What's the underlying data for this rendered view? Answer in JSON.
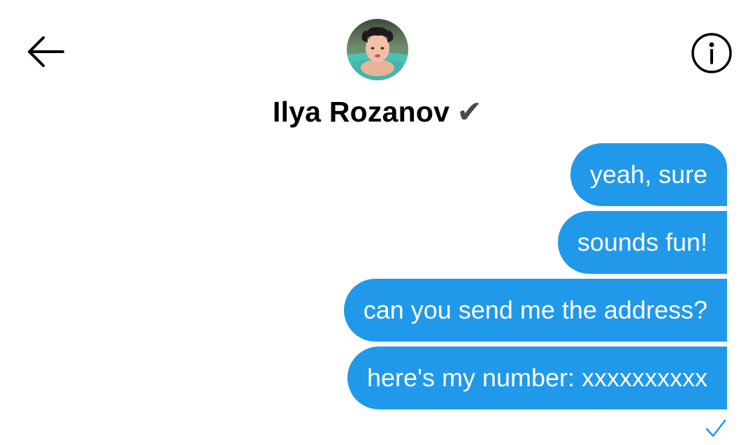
{
  "header": {
    "back_icon": "arrow-left-icon",
    "info_icon": "info-circle-icon",
    "contact_name": "Ilya Rozanov",
    "verified_mark": "✔",
    "avatar_icon": "profile-photo"
  },
  "messages": [
    {
      "text": "yeah, sure"
    },
    {
      "text": "sounds fun!"
    },
    {
      "text": "can you send me the address?"
    },
    {
      "text": "here's my number: xxxxxxxxxx"
    }
  ],
  "status": {
    "icon": "checkmark-icon"
  },
  "colors": {
    "bubble": "#2099ea",
    "bubble_text": "#ffffff",
    "name_text": "#000000",
    "verified": "#4a4a4a",
    "read_check": "#2099ea"
  }
}
